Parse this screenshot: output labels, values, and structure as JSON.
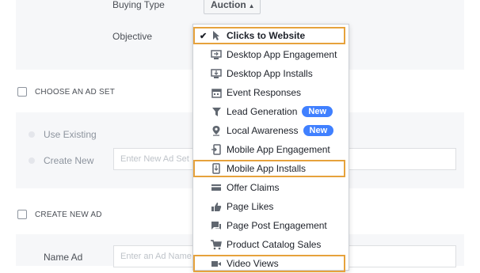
{
  "form": {
    "buying_type_label": "Buying Type",
    "buying_type_value": "Auction",
    "objective_label": "Objective",
    "choose_ad_set_label": "CHOOSE AN AD SET",
    "use_existing_label": "Use Existing",
    "create_new_label": "Create New",
    "ad_set_placeholder": "Enter New Ad Set",
    "create_new_ad_label": "CREATE NEW AD",
    "name_ad_label": "Name Ad",
    "ad_name_placeholder": "Enter an Ad Name"
  },
  "objective_menu": {
    "items": [
      {
        "label": "Clicks to Website",
        "icon": "cursor-icon",
        "selected": true
      },
      {
        "label": "Desktop App Engagement",
        "icon": "desktop-engagement-icon"
      },
      {
        "label": "Desktop App Installs",
        "icon": "desktop-install-icon"
      },
      {
        "label": "Event Responses",
        "icon": "calendar-icon"
      },
      {
        "label": "Lead Generation",
        "icon": "funnel-icon",
        "badge": "New"
      },
      {
        "label": "Local Awareness",
        "icon": "location-pin-icon",
        "badge": "New"
      },
      {
        "label": "Mobile App Engagement",
        "icon": "mobile-engagement-icon"
      },
      {
        "label": "Mobile App Installs",
        "icon": "mobile-install-icon"
      },
      {
        "label": "Offer Claims",
        "icon": "offer-icon"
      },
      {
        "label": "Page Likes",
        "icon": "thumbs-up-icon"
      },
      {
        "label": "Page Post Engagement",
        "icon": "chat-bubble-icon"
      },
      {
        "label": "Product Catalog Sales",
        "icon": "cart-icon"
      },
      {
        "label": "Video Views",
        "icon": "video-icon"
      }
    ]
  },
  "colors": {
    "highlight": "#e6a23c",
    "badge": "#4080ff",
    "panel": "#f6f7f9"
  }
}
